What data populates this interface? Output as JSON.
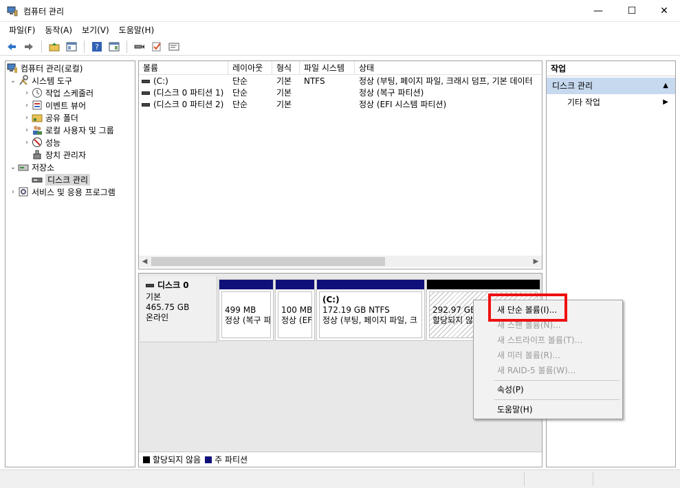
{
  "window": {
    "title": "컴퓨터 관리",
    "controls": {
      "minimize": "—",
      "maximize": "☐",
      "close": "✕"
    }
  },
  "menubar": [
    "파일(F)",
    "동작(A)",
    "보기(V)",
    "도움말(H)"
  ],
  "toolbar": {
    "icons": [
      "back-arrow-icon",
      "forward-arrow-icon",
      "up-folder-icon",
      "show-hide-tree-icon",
      "help-icon",
      "show-hide-action-icon",
      "connect-icon",
      "check-icon",
      "properties-icon"
    ]
  },
  "tree": {
    "root": "컴퓨터 관리(로컬)",
    "system_tools": "시스템 도구",
    "task_scheduler": "작업 스케줄러",
    "event_viewer": "이벤트 뷰어",
    "shared_folders": "공유 폴더",
    "local_users": "로컬 사용자 및 그룹",
    "performance": "성능",
    "device_manager": "장치 관리자",
    "storage": "저장소",
    "disk_management": "디스크 관리",
    "services": "서비스 및 응용 프로그램"
  },
  "volume_list": {
    "columns": [
      "볼륨",
      "레이아웃",
      "형식",
      "파일 시스템",
      "상태"
    ],
    "rows": [
      {
        "volume": "(C:)",
        "layout": "단순",
        "type": "기본",
        "fs": "NTFS",
        "status": "정상 (부팅, 페이지 파일, 크래시 덤프, 기본 데이터"
      },
      {
        "volume": "(디스크 0 파티션 1)",
        "layout": "단순",
        "type": "기본",
        "fs": "",
        "status": "정상 (복구 파티션)"
      },
      {
        "volume": "(디스크 0 파티션 2)",
        "layout": "단순",
        "type": "기본",
        "fs": "",
        "status": "정상 (EFI 시스템 파티션)"
      }
    ]
  },
  "disk": {
    "name": "디스크 0",
    "type": "기본",
    "size": "465.75 GB",
    "state": "온라인",
    "partitions": [
      {
        "title": "",
        "size": "499 MB",
        "desc": "정상 (복구 파"
      },
      {
        "title": "",
        "size": "100 MB",
        "desc": "정상 (EF"
      },
      {
        "title": "(C:)",
        "size": "172.19 GB NTFS",
        "desc": "정상 (부팅, 페이지 파일, 크"
      },
      {
        "title": "",
        "size": "292.97 GB",
        "desc": "할당되지 않음"
      }
    ]
  },
  "legend": {
    "unallocated": "할당되지 않음",
    "primary": "주 파티션",
    "unallocated_color": "#000000",
    "primary_color": "#10107a"
  },
  "actions": {
    "header": "작업",
    "section": "디스크 관리",
    "more": "기타 작업"
  },
  "context_menu": {
    "new_simple": "새 단순 볼륨(I)...",
    "new_spanned": "새 스팬 볼륨(N)...",
    "new_striped": "새 스트라이프 볼륨(T)...",
    "new_mirror": "새 미러 볼륨(R)...",
    "new_raid5": "새 RAID-5 볼륨(W)...",
    "properties": "속성(P)",
    "help": "도움말(H)"
  }
}
